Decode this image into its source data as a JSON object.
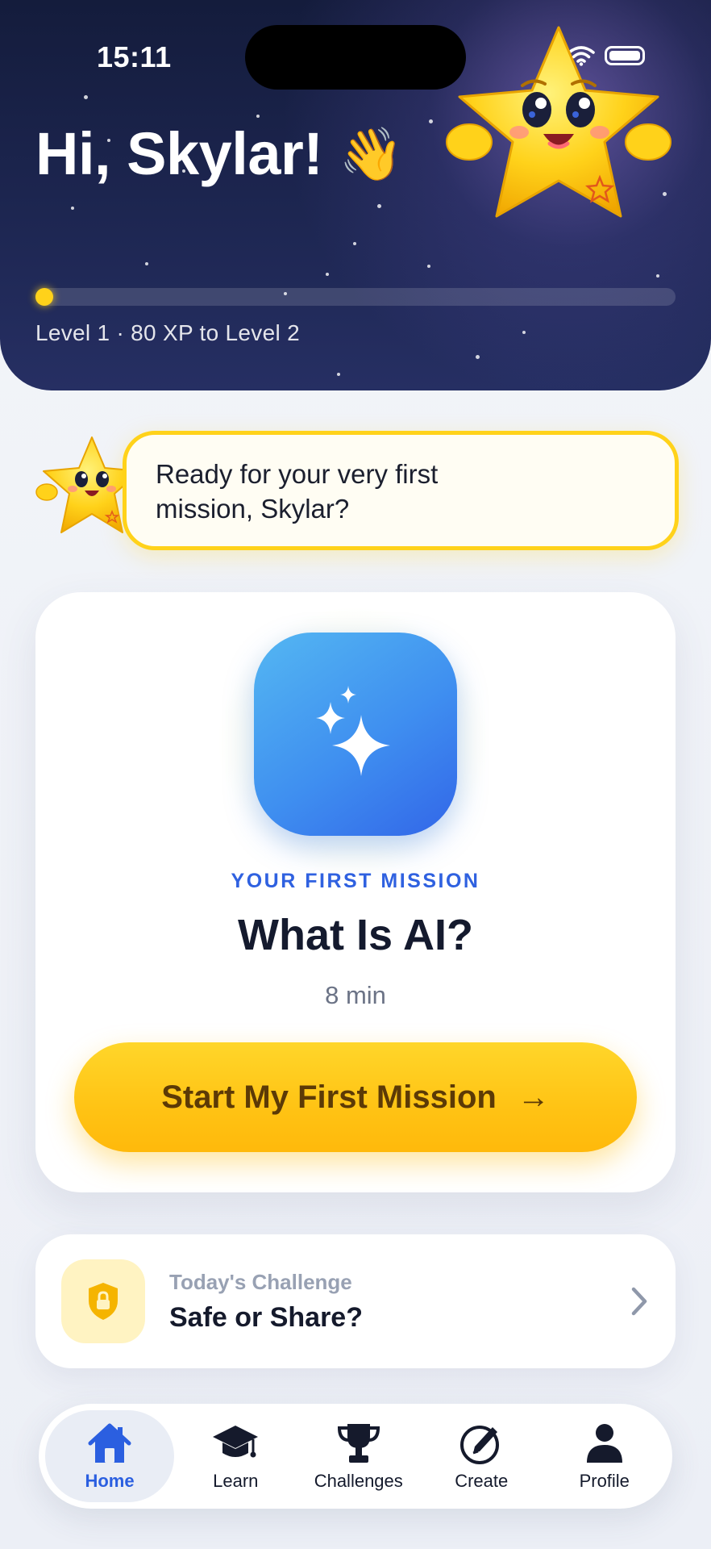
{
  "status_bar": {
    "time": "15:11",
    "icons": [
      "wifi-icon",
      "battery-icon"
    ]
  },
  "header": {
    "greeting": "Hi, Skylar!",
    "greeting_emoji": "👋",
    "mascot": "star-mascot",
    "xp_progress": 0.02,
    "level_text": "Level 1 · 80 XP to Level 2"
  },
  "speech": {
    "line1": "Ready for your very first",
    "line2": "mission, Skylar?"
  },
  "mission": {
    "icon": "sparkles-icon",
    "label": "YOUR FIRST MISSION",
    "title": "What Is AI?",
    "duration": "8 min",
    "button_label": "Start My First Mission",
    "button_arrow": "→"
  },
  "challenge": {
    "icon": "shield-lock-icon",
    "kicker": "Today's Challenge",
    "title": "Safe or Share?"
  },
  "tabs": [
    {
      "label": "Home",
      "icon": "home-icon",
      "active": true
    },
    {
      "label": "Learn",
      "icon": "graduation-cap-icon",
      "active": false
    },
    {
      "label": "Challenges",
      "icon": "trophy-icon",
      "active": false
    },
    {
      "label": "Create",
      "icon": "pencil-circle-icon",
      "active": false
    },
    {
      "label": "Profile",
      "icon": "person-icon",
      "active": false
    }
  ],
  "colors": {
    "header_bg": "#1d2651",
    "accent_yellow": "#ffd21a",
    "accent_blue": "#2f61e0",
    "text_dark": "#141a2e"
  }
}
